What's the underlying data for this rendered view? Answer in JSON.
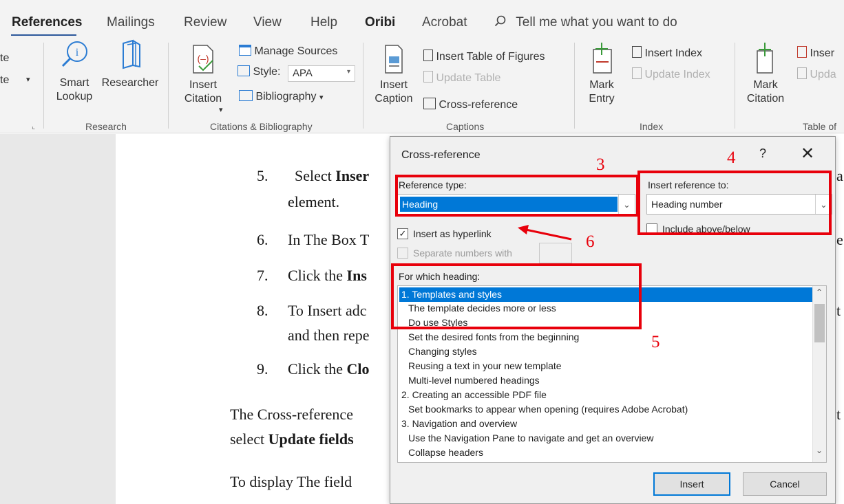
{
  "tabs": [
    {
      "label": "References",
      "active": true
    },
    {
      "label": "Mailings"
    },
    {
      "label": "Review"
    },
    {
      "label": "View"
    },
    {
      "label": "Help"
    },
    {
      "label": "Oribi"
    },
    {
      "label": "Acrobat"
    }
  ],
  "tell_me": "Tell me what you want to do",
  "ribbon": {
    "partial_left_1": "te",
    "partial_left_2": "te",
    "smart_lookup": "Smart Lookup",
    "researcher": "Researcher",
    "insert_citation": "Insert Citation",
    "manage_sources": "Manage Sources",
    "style_label": "Style:",
    "style_value": "APA",
    "bibliography": "Bibliography",
    "insert_caption": "Insert Caption",
    "insert_table_of_figures": "Insert Table of Figures",
    "update_table": "Update Table",
    "cross_reference": "Cross-reference",
    "mark_entry": "Mark Entry",
    "insert_index": "Insert Index",
    "update_index": "Update Index",
    "mark_citation": "Mark Citation",
    "insert_toa": "Inser",
    "update_toa": "Upda",
    "groups": {
      "research": "Research",
      "citations": "Citations & Bibliography",
      "captions": "Captions",
      "index": "Index",
      "table_of": "Table of"
    }
  },
  "document": {
    "item5_num": "5.",
    "item5_pre": "Select ",
    "item5_bold": "Inser",
    "item5_line2": "element.",
    "item6_num": "6.",
    "item6_text": "In The Box T",
    "item7_num": "7.",
    "item7_pre": "Click the ",
    "item7_bold": "Ins",
    "item8_num": "8.",
    "item8_text": "To Insert adc",
    "item8_line2": "and then repe",
    "item9_num": "9.",
    "item9_pre": "Click the ",
    "item9_bold": "Clo",
    "para1_line1": "The Cross-reference",
    "para1_line2_pre": "select ",
    "para1_line2_bold": "Update fields",
    "para2": "To display The field",
    "right_a": "a",
    "right_e": "e",
    "right_t1": "t",
    "right_t2": "t"
  },
  "dialog": {
    "title": "Cross-reference",
    "help": "?",
    "close": "✕",
    "reference_type_label": "Reference type:",
    "reference_type_value": "Heading",
    "insert_reference_label": "Insert reference to:",
    "insert_reference_value": "Heading number",
    "include_above_below": "Include above/below",
    "insert_as_hyperlink": "Insert as hyperlink",
    "separate_numbers": "Separate numbers with",
    "for_which_label": "For which heading:",
    "headings": [
      "1. Templates and styles",
      "The template decides more or less",
      "Do use Styles",
      "Set the desired fonts from the beginning",
      "Changing styles",
      "Reusing a text in your new template",
      "Multi-level numbered headings",
      "2. Creating an accessible PDF file",
      "Set bookmarks to appear when opening (requires Adobe Acrobat)",
      "3. Navigation and overview",
      "Use the Navigation Pane to navigate and get an overview",
      "Collapse headers"
    ],
    "selected_heading_index": 0,
    "insert_button": "Insert",
    "cancel_button": "Cancel"
  },
  "annotations": {
    "n3": "3",
    "n4": "4",
    "n5": "5",
    "n6": "6"
  },
  "colors": {
    "annotation_red": "#e8000b",
    "selection_blue": "#0078d7",
    "tab_underline": "#2b579a"
  }
}
